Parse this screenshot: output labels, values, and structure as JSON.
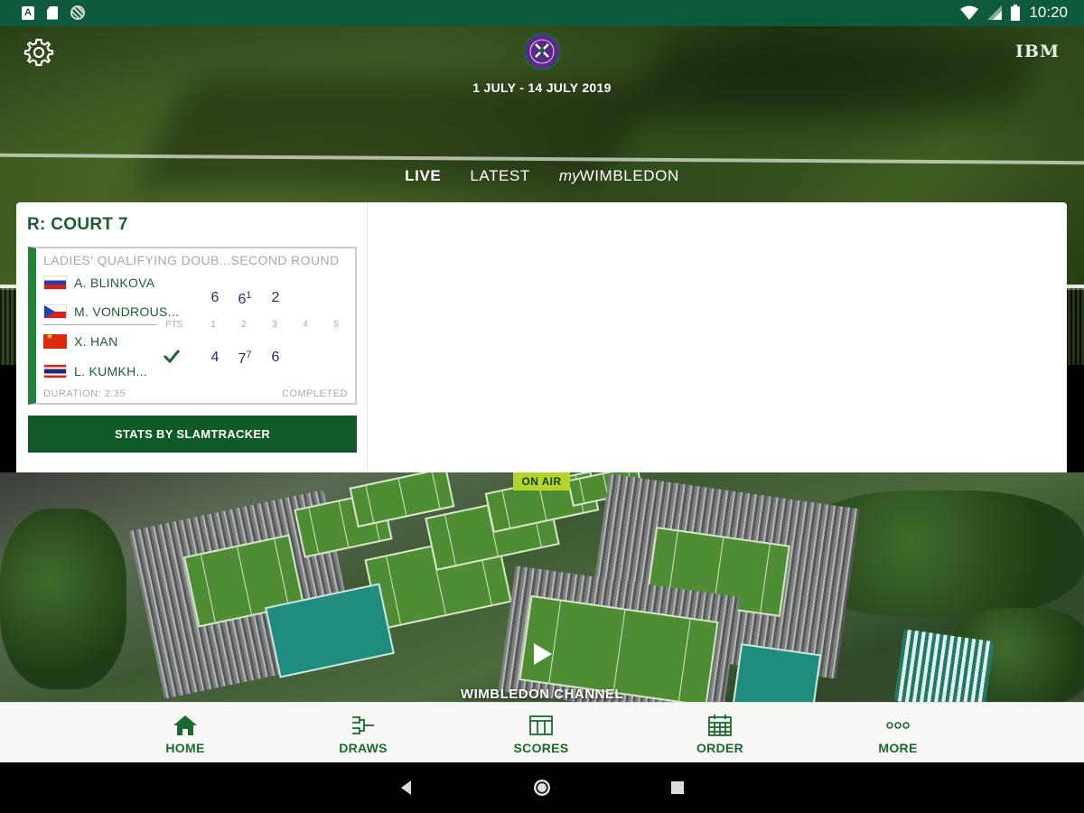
{
  "status_bar": {
    "time": "10:20",
    "left_icons": [
      "a-notification-icon",
      "sd-card-icon",
      "sync-icon"
    ],
    "right_icons": [
      "wifi-icon",
      "signal-icon",
      "battery-icon"
    ]
  },
  "header": {
    "date_range": "1 JULY - 14 JULY 2019",
    "sponsor": "IBM",
    "tabs": [
      {
        "label": "LIVE",
        "active": true
      },
      {
        "label": "LATEST",
        "active": false
      },
      {
        "label_prefix": "my",
        "label_main": "WIMBLEDON",
        "active": false
      }
    ]
  },
  "match": {
    "court": "R: COURT 7",
    "round": "LADIES' QUALIFYING DOUB...SECOND ROUND",
    "team1": [
      {
        "name": "A. BLINKOVA",
        "flag": "RU"
      },
      {
        "name": "M. VONDROUS...",
        "flag": "CZ"
      }
    ],
    "team2": [
      {
        "name": "X. HAN",
        "flag": "CN"
      },
      {
        "name": "L. KUMKH...",
        "flag": "TH"
      }
    ],
    "columns": {
      "pts": "PTS",
      "sets": [
        "1",
        "2",
        "3",
        "4",
        "5"
      ]
    },
    "team1_scores": [
      {
        "main": "6",
        "tb": ""
      },
      {
        "main": "6",
        "tb": "1"
      },
      {
        "main": "2",
        "tb": ""
      }
    ],
    "team2_scores": [
      {
        "main": "4",
        "tb": ""
      },
      {
        "main": "7",
        "tb": "7"
      },
      {
        "main": "6",
        "tb": ""
      }
    ],
    "winner": "team2",
    "duration": "DURATION: 2:35",
    "status": "COMPLETED",
    "stats_button": "STATS BY SLAMTRACKER"
  },
  "video": {
    "badge": "ON AIR",
    "title": "WIMBLEDON CHANNEL"
  },
  "bottom_nav": [
    {
      "label": "HOME",
      "icon": "home-icon",
      "active": true
    },
    {
      "label": "DRAWS",
      "icon": "draws-bracket-icon",
      "active": false
    },
    {
      "label": "SCORES",
      "icon": "scoreboard-icon",
      "active": false
    },
    {
      "label": "ORDER",
      "icon": "calendar-icon",
      "active": false
    },
    {
      "label": "MORE",
      "icon": "more-dots-icon",
      "active": false
    }
  ],
  "colors": {
    "status_bar": "#0d5a3c",
    "brand_green": "#0f5a26",
    "accent_purple": "#3e1d70",
    "on_air": "#b6d52a"
  }
}
